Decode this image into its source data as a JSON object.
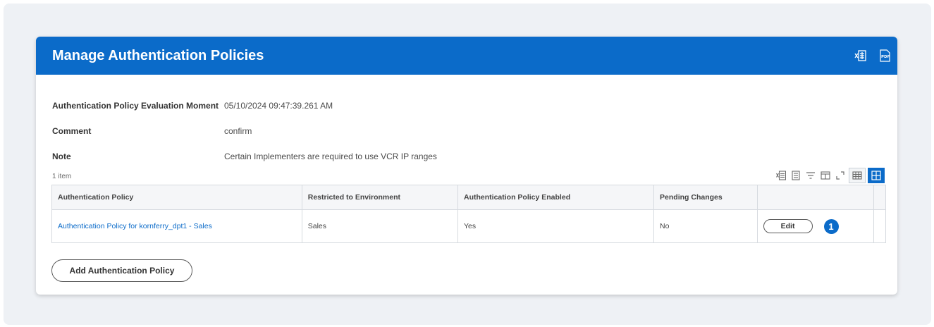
{
  "header": {
    "title": "Manage Authentication Policies",
    "icons": [
      "export-to-excel-icon",
      "export-to-pdf-icon"
    ]
  },
  "fields": [
    {
      "label": "Authentication Policy Evaluation Moment",
      "value": "05/10/2024 09:47:39.261 AM"
    },
    {
      "label": "Comment",
      "value": "confirm"
    },
    {
      "label": "Note",
      "value": "Certain Implementers are required to use VCR IP ranges"
    }
  ],
  "table": {
    "item_count": "1 item",
    "columns": [
      "Authentication Policy",
      "Restricted to Environment",
      "Authentication Policy Enabled",
      "Pending Changes",
      ""
    ],
    "rows": [
      {
        "policy": "Authentication Policy for kornferry_dpt1 - Sales",
        "environment": "Sales",
        "enabled": "Yes",
        "pending": "No",
        "action_label": "Edit",
        "badge": "1"
      }
    ],
    "tool_icons": [
      "export-excel-icon",
      "view-report-icon",
      "filter-icon",
      "columns-icon",
      "fullscreen-icon",
      "table-view-icon",
      "grid-view-icon"
    ]
  },
  "actions": {
    "add_label": "Add Authentication Policy"
  },
  "colors": {
    "brand": "#0b6bc9",
    "background": "#eef1f5"
  }
}
